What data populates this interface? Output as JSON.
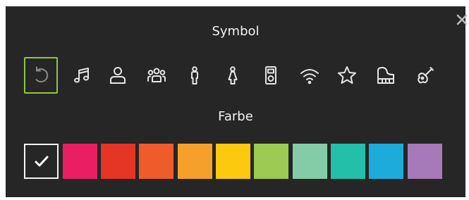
{
  "dialog": {
    "symbol_title": "Symbol",
    "color_title": "Farbe"
  },
  "icons": [
    {
      "name": "reset-icon",
      "selected": true
    },
    {
      "name": "music-note-icon",
      "selected": false
    },
    {
      "name": "person-icon",
      "selected": false
    },
    {
      "name": "group-icon",
      "selected": false
    },
    {
      "name": "man-icon",
      "selected": false
    },
    {
      "name": "woman-icon",
      "selected": false
    },
    {
      "name": "music-player-icon",
      "selected": false
    },
    {
      "name": "wifi-icon",
      "selected": false
    },
    {
      "name": "star-icon",
      "selected": false
    },
    {
      "name": "piano-icon",
      "selected": false
    },
    {
      "name": "guitar-icon",
      "selected": false
    }
  ],
  "colors": [
    {
      "name": "none",
      "hex": "#262626",
      "selected": true
    },
    {
      "name": "pink",
      "hex": "#e91e63",
      "selected": false
    },
    {
      "name": "red",
      "hex": "#e53525",
      "selected": false
    },
    {
      "name": "orange-red",
      "hex": "#f05b2c",
      "selected": false
    },
    {
      "name": "orange",
      "hex": "#f6a02c",
      "selected": false
    },
    {
      "name": "yellow",
      "hex": "#fcc90f",
      "selected": false
    },
    {
      "name": "lime",
      "hex": "#9bcb53",
      "selected": false
    },
    {
      "name": "mint",
      "hex": "#84cca7",
      "selected": false
    },
    {
      "name": "teal",
      "hex": "#23bfa8",
      "selected": false
    },
    {
      "name": "sky-blue",
      "hex": "#1dabdc",
      "selected": false
    },
    {
      "name": "lavender",
      "hex": "#a67ab8",
      "selected": false
    }
  ]
}
